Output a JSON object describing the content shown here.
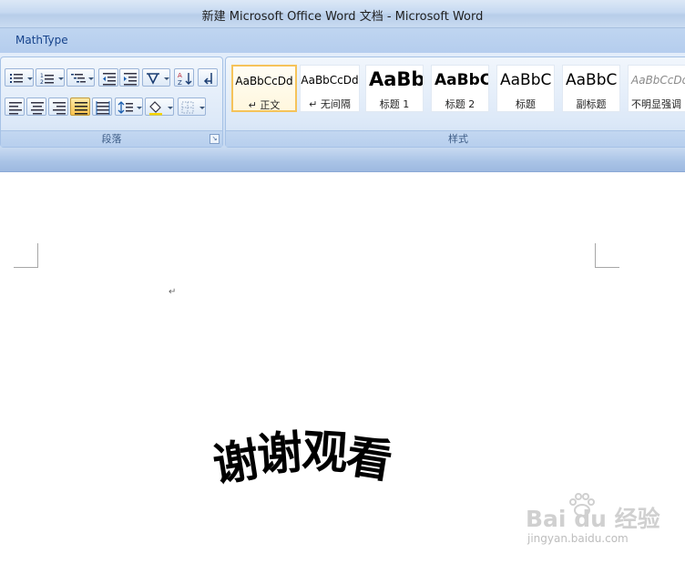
{
  "window": {
    "title": "新建 Microsoft Office Word 文档 - Microsoft Word"
  },
  "ribbon": {
    "tabs": [
      "MathType"
    ],
    "paragraph_group": {
      "label": "段落",
      "launcher_icon": "dialog-launcher-icon"
    },
    "styles_group": {
      "label": "样式",
      "styles": [
        {
          "sample": "AaBbCcDd",
          "name": "↵ 正文",
          "selected": true
        },
        {
          "sample": "AaBbCcDd",
          "name": "↵ 无间隔"
        },
        {
          "sample": "AaBb",
          "name": "标题 1"
        },
        {
          "sample": "AaBbC",
          "name": "标题 2"
        },
        {
          "sample": "AaBbC",
          "name": "标题"
        },
        {
          "sample": "AaBbC",
          "name": "副标题"
        },
        {
          "sample": "AaBbCcDd",
          "name": "不明显强调"
        }
      ]
    }
  },
  "document": {
    "paragraph_mark": "↵",
    "wordart_text": [
      "谢",
      "谢",
      "观",
      "看"
    ]
  },
  "watermark": {
    "main": "Bai du 经验",
    "sub": "jingyan.baidu.com"
  },
  "colors": {
    "accent": "#15428b",
    "selected_style_border": "#f5c35a",
    "active_button": "#f9c24e"
  }
}
